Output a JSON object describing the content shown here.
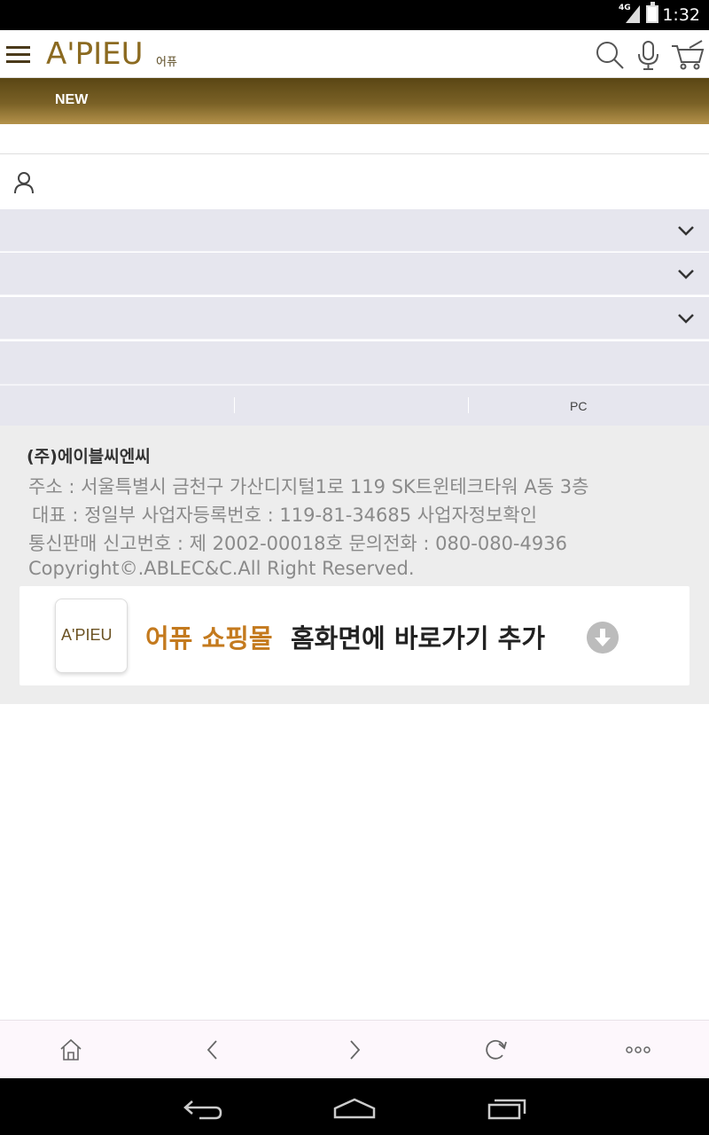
{
  "status_bar": {
    "network": "4G",
    "time": "1:32"
  },
  "header": {
    "logo_text": "A'PIEU",
    "logo_sub": "어퓨",
    "icons": [
      "menu-icon",
      "search-icon",
      "microphone-icon",
      "cart-icon"
    ]
  },
  "nav": {
    "items": [
      {
        "label": "NEW"
      }
    ]
  },
  "login": {
    "icon": "user-icon"
  },
  "accordion": {
    "count": 3,
    "icon": "chevron-down-icon"
  },
  "links": {
    "pc_label": "PC"
  },
  "footer": {
    "company": "(주)에이블씨엔씨",
    "address": "주소 : 서울특별시 금천구 가산디지털1로 119 SK트윈테크타워 A동 3층",
    "ceo_line": "대표 : 정일부  사업자등록번호 : 119-81-34685     사업자정보확인",
    "mail_order_line": "통신판매 신고번호 : 제 2002-00018호   문의전화 : 080-080-4936",
    "copyright": "Copyright©.ABLEC&C.All Right Reserved."
  },
  "banner": {
    "app_icon_text": "A'PIEU",
    "highlight": "어퓨 쇼핑몰",
    "text": "홈화면에 바로가기 추가",
    "highlight_color": "#c47a1e"
  },
  "browser_bar": {
    "icons": [
      "home-icon",
      "back-icon",
      "forward-icon",
      "refresh-icon",
      "more-icon"
    ]
  },
  "system_nav": {
    "icons": [
      "system-back-icon",
      "system-home-icon",
      "recent-apps-icon"
    ]
  },
  "colors": {
    "brand_gold": "#8b6a20",
    "nav_bar": "#7a6126",
    "panel": "#e6e6ee",
    "footer_bg": "#ededed"
  }
}
